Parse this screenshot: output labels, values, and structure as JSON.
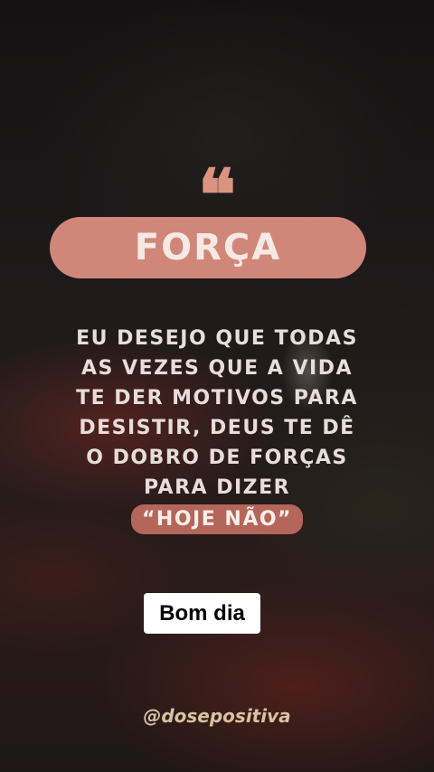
{
  "quote_mark": "❝",
  "title": "FORÇA",
  "message_lines": [
    "EU DESEJO QUE TODAS",
    "AS VEZES QUE A VIDA",
    "TE DER MOTIVOS PARA",
    "DESISTIR, DEUS TE DÊ",
    "O DOBRO DE FORÇAS",
    "PARA DIZER"
  ],
  "highlight": "“HOJE NÃO”",
  "sticker": "Bom dia",
  "handle": "@dosepositiva",
  "colors": {
    "pill": "#d0877a",
    "quote_mark": "#d99482",
    "highlight": "#b4665a",
    "handle": "#d7c3a0"
  }
}
